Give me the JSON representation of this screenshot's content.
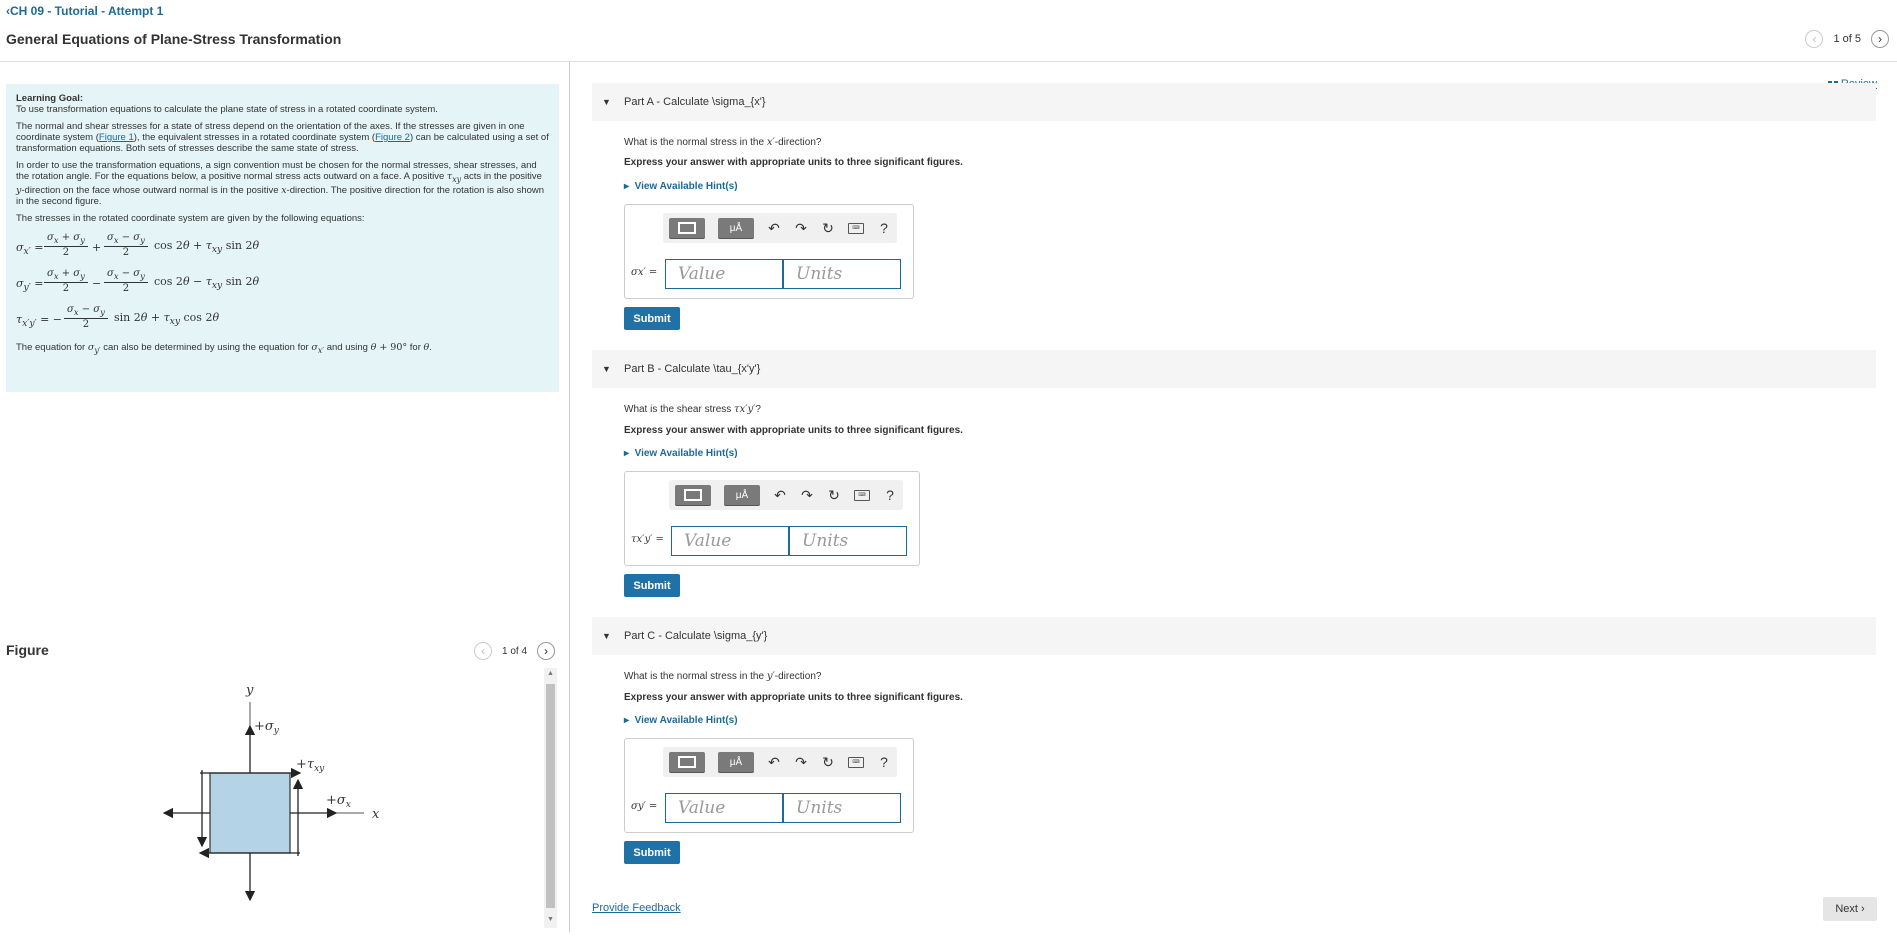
{
  "header": {
    "back_label": "‹CH 09 - Tutorial - Attempt 1",
    "title": "General Equations of Plane-Stress Transformation",
    "pager_text": "1 of 5"
  },
  "goal": {
    "heading": "Learning Goal:",
    "line1": "To use transformation equations to calculate the plane state of stress in a rotated coordinate system.",
    "p2a": "The normal and shear stresses for a state of stress depend on the orientation of the axes. If the stresses are given in one coordinate system (",
    "fig1": "Figure 1",
    "p2b": "), the equivalent stresses in a rotated coordinate system (",
    "fig2": "Figure 2",
    "p2c": ") can be calculated using a set of transformation equations. Both sets of stresses describe the same state of stress.",
    "p3a": "In order to use the transformation equations, a sign convention must be chosen for the normal stresses, shear stresses, and the rotation angle. For the equations below, a positive normal stress acts outward on a face. A positive ",
    "p3b": " acts in the positive ",
    "p3c": "-direction on the face whose outward normal is in the positive ",
    "p3d": "-direction. The positive direction for the rotation is also shown in the second figure.",
    "p4": "The stresses in the rotated coordinate system are given by the following equations:",
    "p5a": "The equation for ",
    "p5b": " can also be determined by using the equation for ",
    "p5c": " and using ",
    "p5d": " for ",
    "p5e": "."
  },
  "figure": {
    "title": "Figure",
    "pager_text": "1 of 4",
    "labels": {
      "y": "y",
      "x": "x",
      "sy": "+σ",
      "sy_sub": "y",
      "txy": "+τ",
      "txy_sub": "xy",
      "sx": "+σ",
      "sx_sub": "x"
    },
    "box_color": "#b5d3e7"
  },
  "review_label": "Review",
  "parts": [
    {
      "header": "Part A - Calculate \\sigma_{x'}",
      "question": "What is the normal stress in the ",
      "question_var": "x′",
      "question_end": "-direction?",
      "express": "Express your answer with appropriate units to three significant figures.",
      "hint": "View Available Hint(s)",
      "var_label": "σx′ =",
      "value_placeholder": "Value",
      "units_placeholder": "Units",
      "submit": "Submit"
    },
    {
      "header": "Part B - Calculate \\tau_{x'y'}",
      "question": "What is the shear stress ",
      "question_var": "τx′y′",
      "question_end": "?",
      "express": "Express your answer with appropriate units to three significant figures.",
      "hint": "View Available Hint(s)",
      "var_label": "τx′y′ =",
      "value_placeholder": "Value",
      "units_placeholder": "Units",
      "submit": "Submit"
    },
    {
      "header": "Part C - Calculate \\sigma_{y'}",
      "question": "What is the normal stress in the ",
      "question_var": "y′",
      "question_end": "-direction?",
      "express": "Express your answer with appropriate units to three significant figures.",
      "hint": "View Available Hint(s)",
      "var_label": "σy′ =",
      "value_placeholder": "Value",
      "units_placeholder": "Units",
      "submit": "Submit"
    }
  ],
  "toolbar": {
    "mu_label": "μÅ",
    "help_label": "?"
  },
  "footer": {
    "feedback": "Provide Feedback",
    "next": "Next ›"
  },
  "colors": {
    "accent": "#2071a6",
    "goal_bg": "#e5f4f6"
  }
}
